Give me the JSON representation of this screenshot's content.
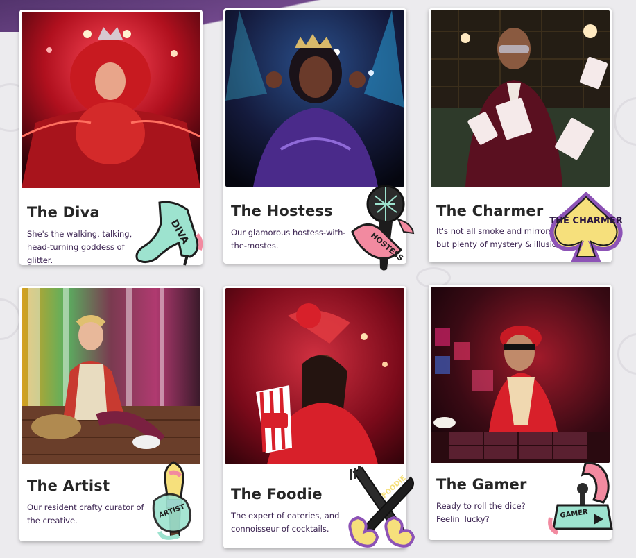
{
  "personas": [
    {
      "name": "The Diva",
      "description": "She's the walking, talking, head-turning goddess of glitter.",
      "sticker_text": "DIVA",
      "icon": "high-heel-icon"
    },
    {
      "name": "The Hostess",
      "description": "Our glamorous hostess-with-the-mostes.",
      "sticker_text": "HOSTESS",
      "icon": "microphone-icon"
    },
    {
      "name": "The Charmer",
      "description": "It's not all smoke and mirrors, but plenty of mystery & illusion.",
      "sticker_text": "THE CHARMER",
      "icon": "spade-icon"
    },
    {
      "name": "The Artist",
      "description": "Our resident crafty curator of the creative.",
      "sticker_text": "ARTIST",
      "icon": "paintbrush-icon"
    },
    {
      "name": "The Foodie",
      "description": "The expert of eateries, and connoisseur of cocktails.",
      "sticker_text": "FOODIE",
      "icon": "fork-knife-icon"
    },
    {
      "name": "The Gamer",
      "description": "Ready to roll the dice? Feelin' lucky?",
      "sticker_text": "GAMER",
      "icon": "joystick-icon"
    }
  ],
  "colors": {
    "background": "#ecebee",
    "band": "#4b2a66",
    "title": "#262626",
    "description": "#3a2250",
    "sticker_mint": "#9de3cf",
    "sticker_pink": "#f28aa0",
    "sticker_yellow": "#f6e07c",
    "sticker_purple": "#8d53b6"
  }
}
